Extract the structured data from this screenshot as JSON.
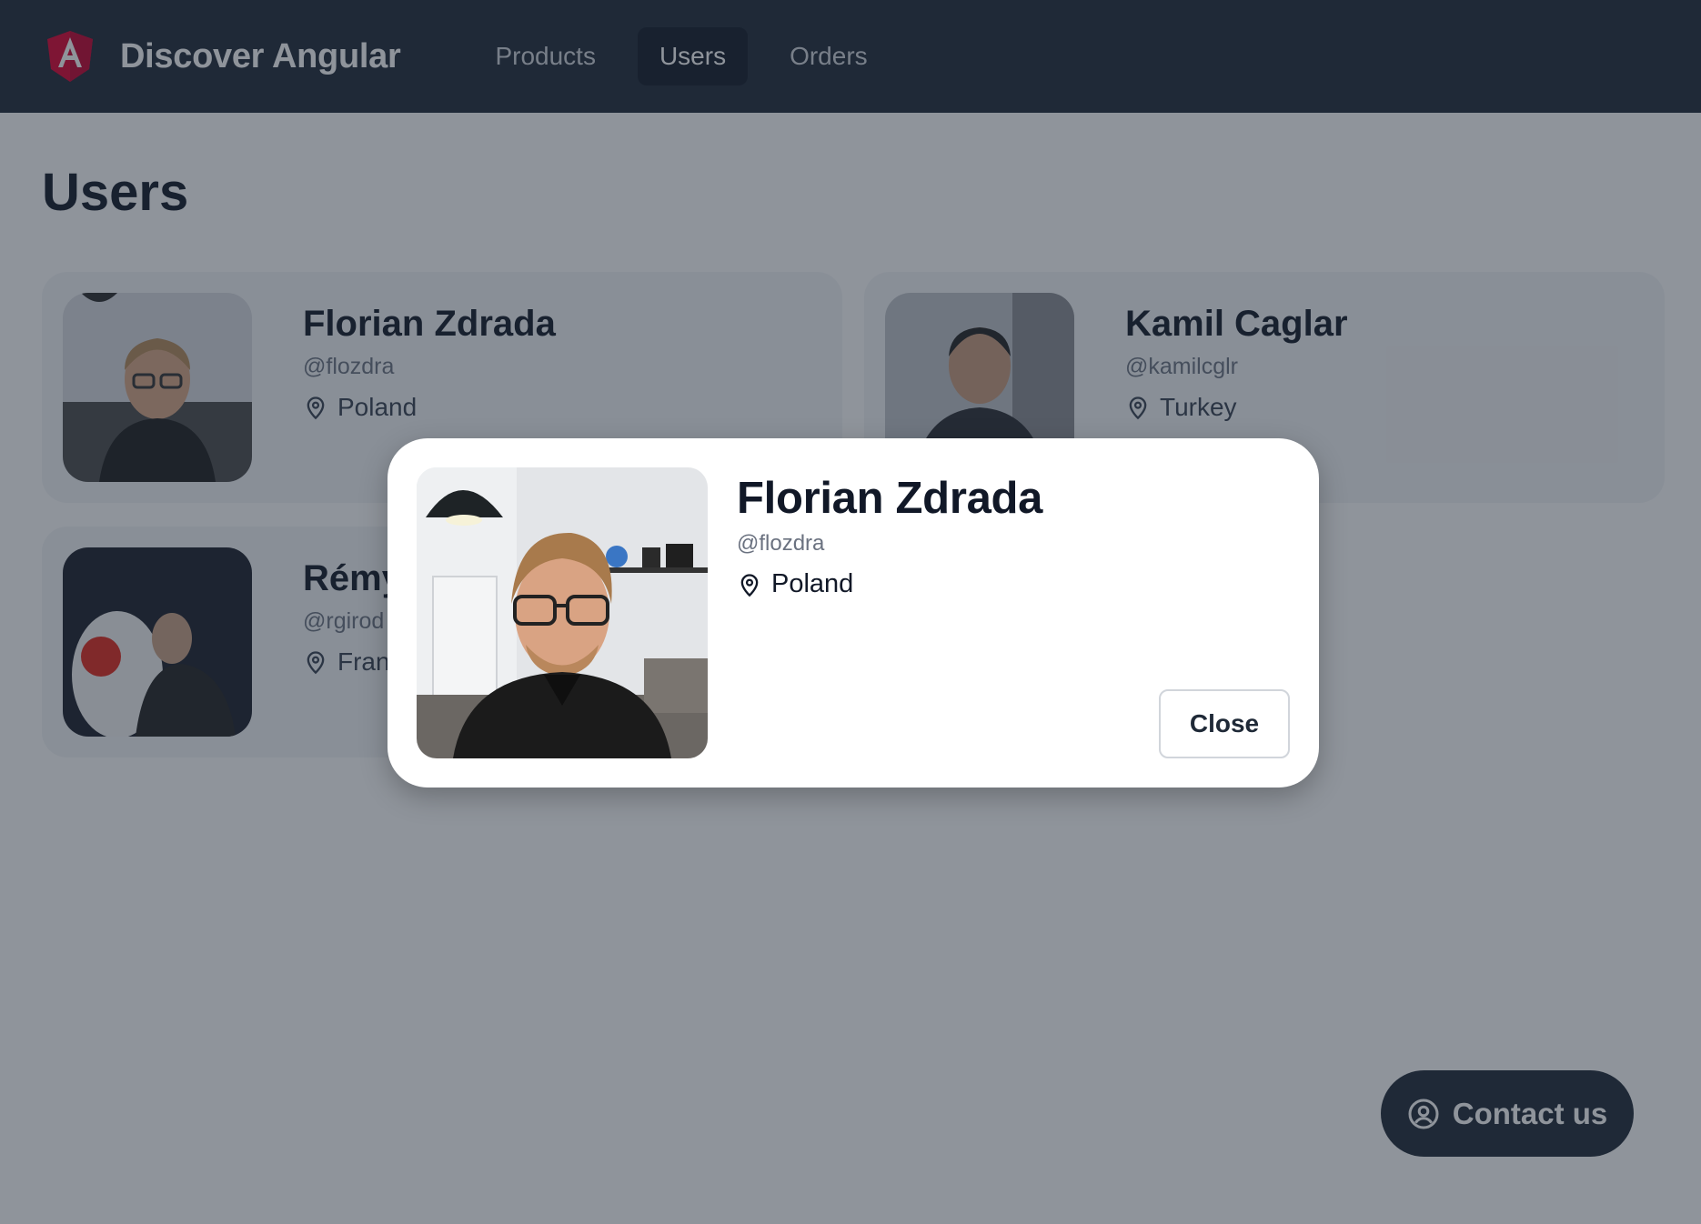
{
  "header": {
    "app_title": "Discover Angular",
    "nav": [
      {
        "label": "Products",
        "active": false
      },
      {
        "label": "Users",
        "active": true
      },
      {
        "label": "Orders",
        "active": false
      }
    ]
  },
  "main": {
    "page_title": "Users",
    "users": [
      {
        "name": "Florian Zdrada",
        "handle": "@flozdra",
        "location": "Poland"
      },
      {
        "name": "Kamil Caglar",
        "handle": "@kamilcglr",
        "location": "Turkey"
      },
      {
        "name": "Rémy",
        "handle": "@rgirod",
        "location": "Fran"
      }
    ]
  },
  "modal": {
    "name": "Florian Zdrada",
    "handle": "@flozdra",
    "location": "Poland",
    "close_label": "Close"
  },
  "contact": {
    "label": "Contact us"
  },
  "colors": {
    "header_bg": "#1f2937",
    "angular_red": "#dd0031",
    "overlay": "rgba(31,41,55,0.5)"
  }
}
